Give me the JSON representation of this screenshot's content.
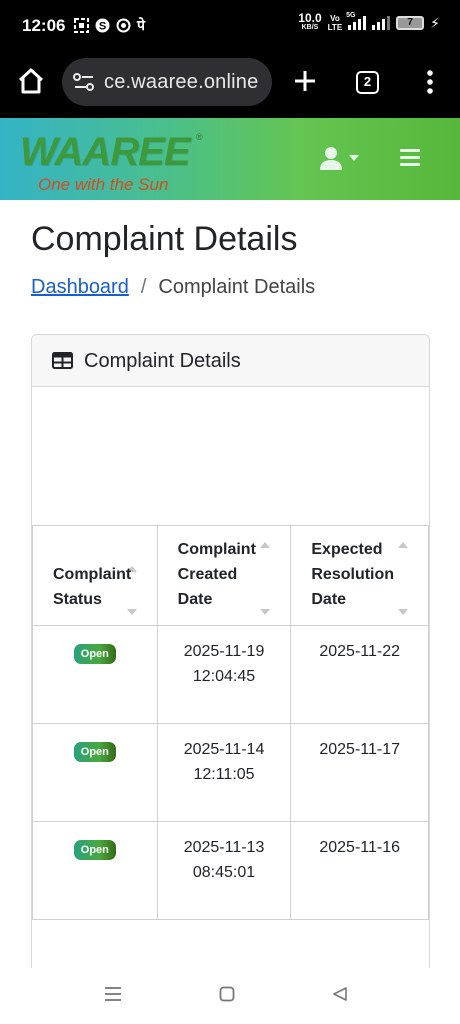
{
  "status_bar": {
    "time": "12:06",
    "notification_icons": [
      "screenshot-icon",
      "skype-icon",
      "p-app-icon",
      "phonepe-icon"
    ],
    "phonepe_glyph": "पे",
    "net_speed": "10.0",
    "net_speed_unit": "KB/S",
    "volte_top": "Vo",
    "volte_bottom": "LTE",
    "network": "5G",
    "battery": "7"
  },
  "browser": {
    "url": "ce.waaree.online",
    "tab_count": "2"
  },
  "site": {
    "logo_text": "WAAREE",
    "logo_registered": "®",
    "logo_tagline": "One with the Sun",
    "colors": {
      "header_gradient": [
        "#34b3c6",
        "#64c552"
      ],
      "logo_green": "#3c9a3c",
      "tagline_orange": "#d84a1b"
    }
  },
  "page": {
    "title": "Complaint Details",
    "breadcrumb": {
      "home_label": "Dashboard",
      "separator": "/",
      "current_label": "Complaint Details"
    }
  },
  "card": {
    "title": "Complaint Details",
    "table": {
      "headers": [
        [
          "Complaint",
          "Status"
        ],
        [
          "Complaint",
          "Created",
          "Date"
        ],
        [
          "Expected",
          "Resolution",
          "Date"
        ]
      ],
      "rows": [
        {
          "status": "Open",
          "created_date": "2025-11-19",
          "created_time": "12:04:45",
          "expected": "2025-11-22"
        },
        {
          "status": "Open",
          "created_date": "2025-11-14",
          "created_time": "12:11:05",
          "expected": "2025-11-17"
        },
        {
          "status": "Open",
          "created_date": "2025-11-13",
          "created_time": "08:45:01",
          "expected": "2025-11-16"
        }
      ]
    }
  }
}
